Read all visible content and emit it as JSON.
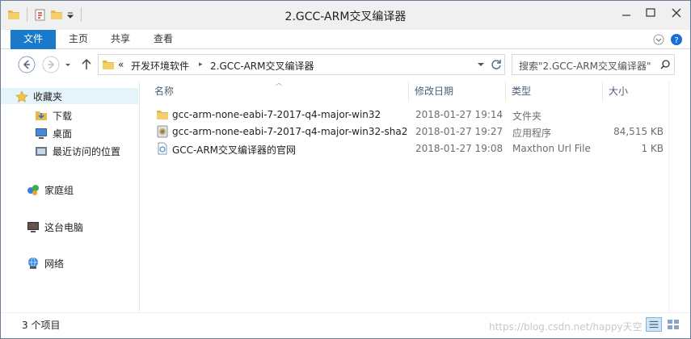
{
  "window": {
    "title": "2.GCC-ARM交叉编译器"
  },
  "ribbon": {
    "tabs": [
      {
        "label": "文件",
        "active": true
      },
      {
        "label": "主页"
      },
      {
        "label": "共享"
      },
      {
        "label": "查看"
      }
    ]
  },
  "address": {
    "overflow": "«",
    "crumbs": [
      "开发环境软件",
      "2.GCC-ARM交叉编译器"
    ],
    "separator": "▸"
  },
  "search": {
    "placeholder": "搜索\"2.GCC-ARM交叉编译器\""
  },
  "nav_pane": {
    "favorites": {
      "label": "收藏夹",
      "icon": "star-icon"
    },
    "favorite_items": [
      {
        "label": "下载",
        "icon": "download-folder-icon"
      },
      {
        "label": "桌面",
        "icon": "desktop-icon"
      },
      {
        "label": "最近访问的位置",
        "icon": "recent-places-icon"
      }
    ],
    "homegroup": {
      "label": "家庭组",
      "icon": "homegroup-icon"
    },
    "this_pc": {
      "label": "这台电脑",
      "icon": "computer-icon"
    },
    "network": {
      "label": "网络",
      "icon": "network-icon"
    }
  },
  "columns": {
    "name": "名称",
    "modified": "修改日期",
    "type": "类型",
    "size": "大小"
  },
  "files": [
    {
      "name": "gcc-arm-none-eabi-7-2017-q4-major-win32",
      "modified": "2018-01-27 19:14",
      "type": "文件夹",
      "size": "",
      "icon": "folder-icon"
    },
    {
      "name": "gcc-arm-none-eabi-7-2017-q4-major-win32-sha2",
      "modified": "2018-01-27 19:27",
      "type": "应用程序",
      "size": "84,515 KB",
      "icon": "installer-icon"
    },
    {
      "name": "GCC-ARM交叉编译器的官网",
      "modified": "2018-01-27 19:08",
      "type": "Maxthon Url File",
      "size": "1 KB",
      "icon": "url-file-icon"
    }
  ],
  "status": {
    "count": "3 个项目",
    "watermark": "https://blog.csdn.net/happy天空"
  },
  "colors": {
    "accent": "#1979ca",
    "folder": "#e8b84a",
    "selection": "#e5f3fb"
  }
}
